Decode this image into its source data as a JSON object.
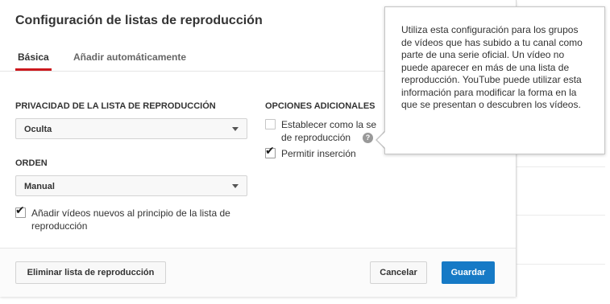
{
  "dialog": {
    "title": "Configuración de listas de reproducción",
    "tabs": [
      {
        "label": "Básica",
        "active": true
      },
      {
        "label": "Añadir automáticamente",
        "active": false
      }
    ],
    "privacy": {
      "label": "PRIVACIDAD DE LA LISTA DE REPRODUCCIÓN",
      "value": "Oculta"
    },
    "order": {
      "label": "ORDEN",
      "value": "Manual"
    },
    "add_to_top": {
      "checked": true,
      "line1": "Añadir vídeos nuevos al principio de la lista de",
      "line2": "reproducción"
    },
    "additional": {
      "label": "OPCIONES ADICIONALES",
      "official_series": {
        "checked": false,
        "line1": "Establecer como la se",
        "line2": "de reproducción"
      },
      "allow_embedding": {
        "checked": true,
        "label": "Permitir inserción"
      }
    },
    "footer": {
      "delete_label": "Eliminar lista de reproducción",
      "cancel_label": "Cancelar",
      "save_label": "Guardar"
    }
  },
  "tooltip": {
    "text": "Utiliza esta configuración para los grupos de vídeos que has subido a tu canal como parte de una serie oficial. Un vídeo no puede aparecer en más de una lista de reproducción. YouTube puede utilizar esta información para modificar la forma en la que se presentan o descubren los vídeos."
  },
  "colors": {
    "accent_red": "#cc181e",
    "primary_blue": "#167ac6"
  },
  "icons": {
    "help": "question-mark-icon",
    "checkmark": "checkmark-icon",
    "dropdown": "caret-down-icon"
  }
}
